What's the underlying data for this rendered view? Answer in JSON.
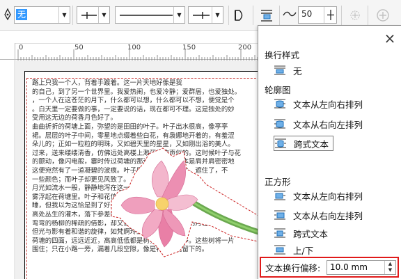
{
  "toolbar": {
    "fill_combo_value": "无",
    "arrow_start_glyph": "⟵",
    "arrow_end_glyph": "⟶",
    "offset_value": "50",
    "icons": [
      "pen-icon",
      "line-start-icon",
      "line-style-icon",
      "line-end-icon",
      "shape-icon",
      "wrap-text-icon",
      "curve-icon",
      "add-icon",
      "plus-circle-icon"
    ]
  },
  "ruler": {
    "labels": [
      "0",
      "50",
      "100",
      "150",
      "200"
    ]
  },
  "document": {
    "lines": [
      "路上只我一个人，背着手踱着。这一片天地好像是我",
      "的自己，到了另一个世界里。我爱热闹，也爱冷静；爱群居，也爱独处。",
      "，一个人在这苍茫的月下，什么都可以想，什么都可以不想，便觉是个",
      "。白天里一定要做的事，一定要说的话，现在都可不理。这是独处的妙",
      "受用这无边的荷香月色好了。",
      "曲曲折折的荷塘上面，弥望的是田田的叶子。叶子出水很高，像亭亭",
      "裙。层层的叶子中间，零星地点缀着些白花，有袅娜地开着的，有羞涩",
      "朵儿的；正如一粒粒的明珠，又如碧天里的星星，又如刚出浴的美人。",
      "过来，送来缕缕清香，仿佛远处高楼上渺茫的歌声似的。这时候叶子与花",
      "的颤动，像闪电般，霎时传过荷塘的那边去了。叶子本是肩并肩密密地",
      "这便宛然有了一道凝碧的波痕。叶子底下是脉脉的流水，遮住了，不",
      "一些颜色；而叶子却更见风致了。",
      "月光如流水一般，静静地泻在这一片叶子和花上。",
      "雾浮起在荷塘里。叶子和花仿佛在牛乳中洗过一样；",
      "睡，但我以为这恰是到了好处——酣眠固不可少，小睡也别有风味的。",
      "高处丛生的灌木，落下参差的斑驳的黑影，峭楞楞如鬼一般；",
      "弯弯的杨柳的稀疏的倩影，却又像是画在荷叶上。塘中的月色并不均匀；",
      "但光与影有着和谐的旋律，如梵婀玲上奏着的名曲。",
      "荷塘的四面，远远近近，高高低低都是树，而杨柳最多。这些树将一片",
      "围住；只在小路一旁，漏着几段空隙，像是特为月光留下的。"
    ]
  },
  "panel": {
    "close_glyph": "×",
    "section_wrap_style": "换行样式",
    "item_none": "无",
    "section_contour": "轮廓图",
    "item_contour_ltr": "文本从左向右排列",
    "item_contour_rtl": "文本从右向左排列",
    "item_contour_straddle": "跨式文本",
    "section_square": "正方形",
    "item_square_ltr": "文本从左向右排列",
    "item_square_rtl": "文本从右向左排列",
    "item_square_straddle": "跨式文本",
    "item_square_topbottom": "上/下",
    "offset_label": "文本换行偏移:",
    "offset_value": "10.0 mm"
  }
}
